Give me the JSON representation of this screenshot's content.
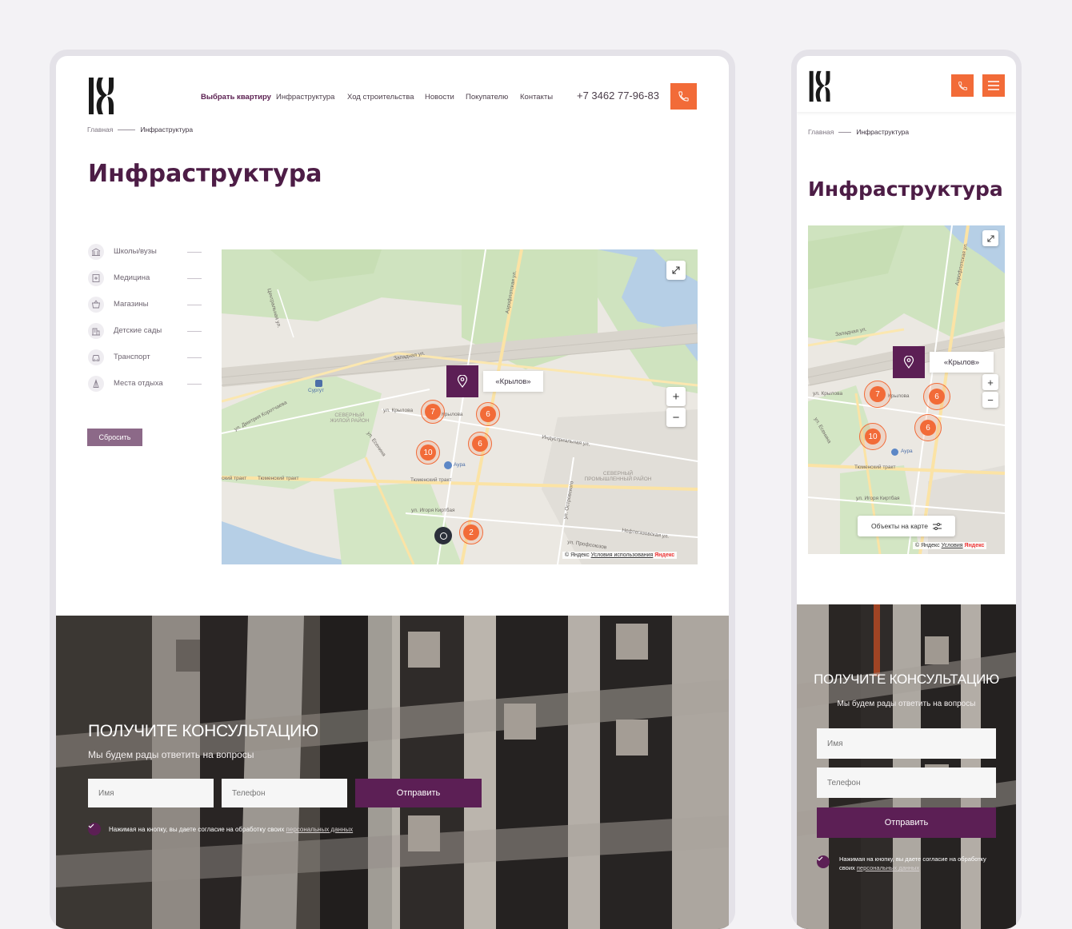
{
  "brand": {
    "logo_text": "K",
    "accent": "#f26b38",
    "primary": "#5c1f55"
  },
  "header": {
    "nav": [
      "Выбрать квартиру",
      "Инфраструктура",
      "Ход строительства",
      "Новости",
      "Покупателю",
      "Контакты"
    ],
    "phone": "+7 3462 77-96-83"
  },
  "breadcrumb": {
    "home": "Главная",
    "current": "Инфраструктура"
  },
  "page_title": "Инфраструктура",
  "filters": [
    "Школы/вузы",
    "Медицина",
    "Магазины",
    "Детские сады",
    "Транспорт",
    "Места отдыха"
  ],
  "reset_label": "Сбросить",
  "map": {
    "pin_label": "«Крылов»",
    "clusters_desktop": [
      "7",
      "6",
      "6",
      "10",
      "2"
    ],
    "clusters_mobile": [
      "7",
      "6",
      "6",
      "10"
    ],
    "zoom_in": "+",
    "zoom_out": "−",
    "copyright": "© Яндекс",
    "terms_desktop": "Условия использования",
    "terms_mobile": "Условия",
    "yandex": "Яндекс",
    "objects_label": "Объекты на карте",
    "labels": {
      "surgut": "Сургут",
      "north_res": "СЕВЕРНЫЙ ЖИЛОЙ РАЙОН",
      "north_ind": "СЕВЕРНЫЙ ПРОМЫШЛЕННЫЙ РАЙОН",
      "krylova": "ул. Крылова",
      "krylova2": "Крылова",
      "zapadnaya": "Западная ул.",
      "aeroflot": "Аэрофлотская ул.",
      "industr": "Индустриальная ул.",
      "tyumen": "Тюменский тракт",
      "tyumen_left": "ский тракт",
      "kirtbaya": "ул. Игоря Киртбая",
      "aura": "Аура",
      "esenina": "ул. Есенина",
      "korotchaeva": "ул. Дмитрия Коротчаева",
      "centralnaya": "Центральная ул.",
      "ostrovskogo": "ул. Островского",
      "neftegaz": "Нефтегазовская ул.",
      "profsoyuzov": "ул. Профсоюзов"
    }
  },
  "consult": {
    "title": "ПОЛУЧИТЕ КОНСУЛЬТАЦИЮ",
    "subtitle": "Мы будем рады ответить на вопросы",
    "name_placeholder": "Имя",
    "phone_placeholder": "Телефон",
    "submit": "Отправить",
    "agree_text": "Нажимая на кнопку, вы даете согласие на обработку своих",
    "agree_link": "персональных данных"
  }
}
